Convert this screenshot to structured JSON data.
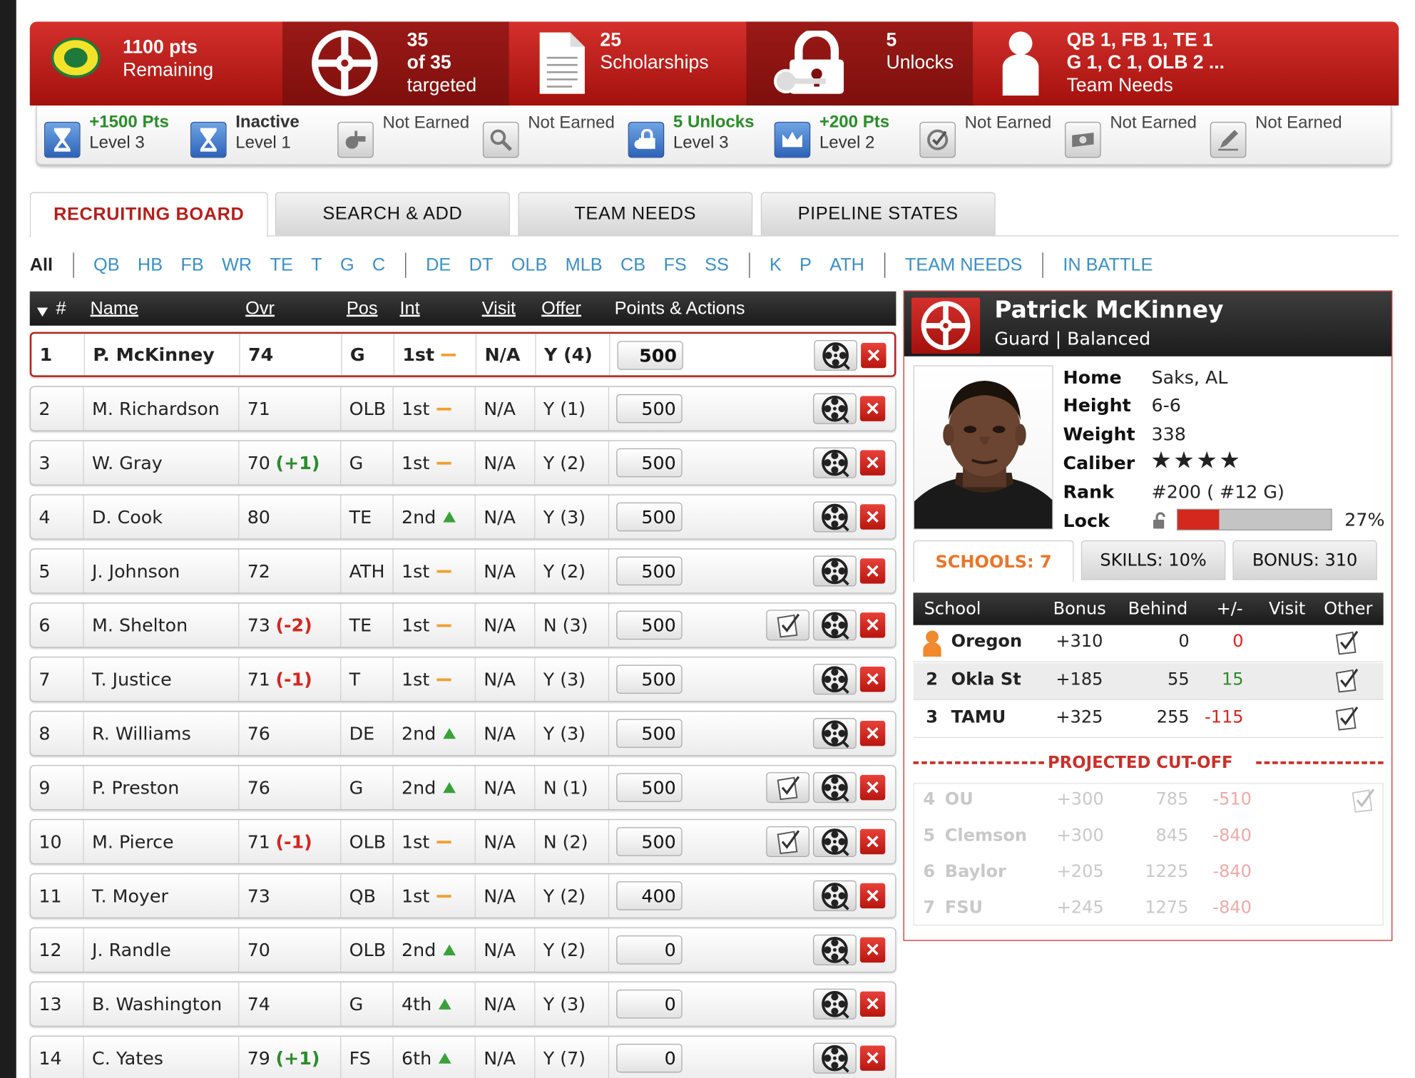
{
  "topbar": {
    "points_value": "1100 pts",
    "points_label": "Remaining",
    "targeted_line1": "35",
    "targeted_line2": "of 35",
    "targeted_line3": "targeted",
    "scholarships_value": "25",
    "scholarships_label": "Scholarships",
    "unlocks_value": "5",
    "unlocks_label": "Unlocks",
    "needs_line1": "QB 1, FB 1, TE 1",
    "needs_line2": "G 1, C 1, OLB 2 ...",
    "needs_label": "Team Needs",
    "logo_letter": "O"
  },
  "achievements": [
    {
      "line1": "+1500 Pts",
      "line2": "Level 3",
      "icon": "hourglass-icon",
      "style": "green"
    },
    {
      "line1": "Inactive",
      "line2": "Level 1",
      "icon": "hourglass-icon",
      "style": "bold"
    },
    {
      "line1": "Not Earned",
      "line2": "",
      "icon": "whistle-icon",
      "style": "plain"
    },
    {
      "line1": "Not Earned",
      "line2": "",
      "icon": "magnifier-icon",
      "style": "plain"
    },
    {
      "line1": "5 Unlocks",
      "line2": "Level 3",
      "icon": "keys-icon",
      "style": "green"
    },
    {
      "line1": "+200 Pts",
      "line2": "Level 2",
      "icon": "crown-icon",
      "style": "green"
    },
    {
      "line1": "Not Earned",
      "line2": "",
      "icon": "check-circle-icon",
      "style": "plain"
    },
    {
      "line1": "Not Earned",
      "line2": "",
      "icon": "money-icon",
      "style": "plain"
    },
    {
      "line1": "Not Earned",
      "line2": "",
      "icon": "pen-icon",
      "style": "plain"
    }
  ],
  "tabs": [
    "RECRUITING BOARD",
    "SEARCH & ADD",
    "TEAM NEEDS",
    "PIPELINE STATES"
  ],
  "filters": {
    "all": "All",
    "group1": [
      "QB",
      "HB",
      "FB",
      "WR",
      "TE",
      "T",
      "G",
      "C"
    ],
    "group2": [
      "DE",
      "DT",
      "OLB",
      "MLB",
      "CB",
      "FS",
      "SS"
    ],
    "group3": [
      "K",
      "P",
      "ATH"
    ],
    "team_needs": "TEAM NEEDS",
    "in_battle": "IN BATTLE"
  },
  "board": {
    "columns": {
      "num": "#",
      "name": "Name",
      "ovr": "Ovr",
      "pos": "Pos",
      "int": "Int",
      "visit": "Visit",
      "offer": "Offer",
      "actions": "Points & Actions"
    },
    "rows": [
      {
        "num": "1",
        "name": "P. McKinney",
        "ovr": "74",
        "delta": "",
        "pos": "G",
        "int": "1st",
        "trend": "flat",
        "visit": "N/A",
        "offer": "Y (4)",
        "points": "500",
        "visit_btn": false
      },
      {
        "num": "2",
        "name": "M. Richardson",
        "ovr": "71",
        "delta": "",
        "pos": "OLB",
        "int": "1st",
        "trend": "flat",
        "visit": "N/A",
        "offer": "Y (1)",
        "points": "500",
        "visit_btn": false
      },
      {
        "num": "3",
        "name": "W. Gray",
        "ovr": "70",
        "delta": "(+1)",
        "pos": "G",
        "int": "1st",
        "trend": "flat",
        "visit": "N/A",
        "offer": "Y (2)",
        "points": "500",
        "visit_btn": false
      },
      {
        "num": "4",
        "name": "D. Cook",
        "ovr": "80",
        "delta": "",
        "pos": "TE",
        "int": "2nd",
        "trend": "up",
        "visit": "N/A",
        "offer": "Y (3)",
        "points": "500",
        "visit_btn": false
      },
      {
        "num": "5",
        "name": "J. Johnson",
        "ovr": "72",
        "delta": "",
        "pos": "ATH",
        "int": "1st",
        "trend": "flat",
        "visit": "N/A",
        "offer": "Y (2)",
        "points": "500",
        "visit_btn": false
      },
      {
        "num": "6",
        "name": "M. Shelton",
        "ovr": "73",
        "delta": "(-2)",
        "pos": "TE",
        "int": "1st",
        "trend": "flat",
        "visit": "N/A",
        "offer": "N (3)",
        "points": "500",
        "visit_btn": true
      },
      {
        "num": "7",
        "name": "T. Justice",
        "ovr": "71",
        "delta": "(-1)",
        "pos": "T",
        "int": "1st",
        "trend": "flat",
        "visit": "N/A",
        "offer": "Y (3)",
        "points": "500",
        "visit_btn": false
      },
      {
        "num": "8",
        "name": "R. Williams",
        "ovr": "76",
        "delta": "",
        "pos": "DE",
        "int": "2nd",
        "trend": "up",
        "visit": "N/A",
        "offer": "Y (3)",
        "points": "500",
        "visit_btn": false
      },
      {
        "num": "9",
        "name": "P. Preston",
        "ovr": "76",
        "delta": "",
        "pos": "G",
        "int": "2nd",
        "trend": "up",
        "visit": "N/A",
        "offer": "N (1)",
        "points": "500",
        "visit_btn": true
      },
      {
        "num": "10",
        "name": "M. Pierce",
        "ovr": "71",
        "delta": "(-1)",
        "pos": "OLB",
        "int": "1st",
        "trend": "flat",
        "visit": "N/A",
        "offer": "N (2)",
        "points": "500",
        "visit_btn": true
      },
      {
        "num": "11",
        "name": "T. Moyer",
        "ovr": "73",
        "delta": "",
        "pos": "QB",
        "int": "1st",
        "trend": "flat",
        "visit": "N/A",
        "offer": "Y (2)",
        "points": "400",
        "visit_btn": false
      },
      {
        "num": "12",
        "name": "J. Randle",
        "ovr": "70",
        "delta": "",
        "pos": "OLB",
        "int": "2nd",
        "trend": "up",
        "visit": "N/A",
        "offer": "Y (2)",
        "points": "0",
        "visit_btn": false
      },
      {
        "num": "13",
        "name": "B. Washington",
        "ovr": "74",
        "delta": "",
        "pos": "G",
        "int": "4th",
        "trend": "up",
        "visit": "N/A",
        "offer": "Y (3)",
        "points": "0",
        "visit_btn": false
      },
      {
        "num": "14",
        "name": "C. Yates",
        "ovr": "79",
        "delta": "(+1)",
        "pos": "FS",
        "int": "6th",
        "trend": "up",
        "visit": "N/A",
        "offer": "Y (7)",
        "points": "0",
        "visit_btn": false
      }
    ]
  },
  "player": {
    "name": "Patrick McKinney",
    "subtitle": "Guard | Balanced",
    "labels": {
      "home": "Home",
      "height": "Height",
      "weight": "Weight",
      "caliber": "Caliber",
      "rank": "Rank",
      "lock": "Lock"
    },
    "home": "Saks, AL",
    "height": "6-6",
    "weight": "338",
    "caliber_stars": 4,
    "rank": "#200 ( #12 G)",
    "lock_percent_text": "27%",
    "lock_fraction": 0.27,
    "tabs": [
      "SCHOOLS: 7",
      "SKILLS: 10%",
      "BONUS: 310"
    ],
    "schools_columns": {
      "school": "School",
      "bonus": "Bonus",
      "behind": "Behind",
      "plusminus": "+/-",
      "visit": "Visit",
      "other": "Other"
    },
    "schools": [
      {
        "rank": "",
        "name": "Oregon",
        "bonus": "+310",
        "behind": "0",
        "diff": "0",
        "diff_color": "red"
      },
      {
        "rank": "2",
        "name": "Okla St",
        "bonus": "+185",
        "behind": "55",
        "diff": "15",
        "diff_color": "green"
      },
      {
        "rank": "3",
        "name": "TAMU",
        "bonus": "+325",
        "behind": "255",
        "diff": "-115",
        "diff_color": "red"
      }
    ],
    "cutoff_label": "PROJECTED CUT-OFF",
    "below_cutoff": [
      {
        "rank": "4",
        "name": "OU",
        "bonus": "+300",
        "behind": "785",
        "diff": "-510"
      },
      {
        "rank": "5",
        "name": "Clemson",
        "bonus": "+300",
        "behind": "845",
        "diff": "-840"
      },
      {
        "rank": "6",
        "name": "Baylor",
        "bonus": "+205",
        "behind": "1225",
        "diff": "-840"
      },
      {
        "rank": "7",
        "name": "FSU",
        "bonus": "+245",
        "behind": "1275",
        "diff": "-840"
      }
    ]
  },
  "colors": {
    "brand_red": "#b3201c",
    "link_blue": "#3b8fc4",
    "green": "#2b8c2a",
    "orange": "#e8762a",
    "oregon_yellow": "#f2e32a",
    "oregon_green": "#1e7a3a"
  }
}
